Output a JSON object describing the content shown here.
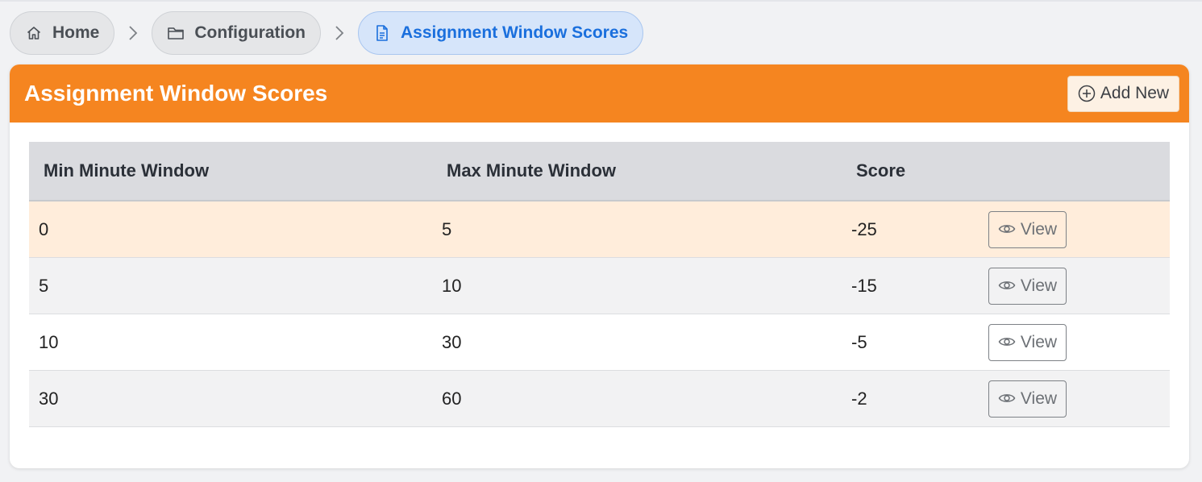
{
  "breadcrumb": {
    "items": [
      {
        "label": "Home",
        "icon": "home-icon"
      },
      {
        "label": "Configuration",
        "icon": "folder-icon"
      },
      {
        "label": "Assignment Window Scores",
        "icon": "document-icon"
      }
    ]
  },
  "card": {
    "title": "Assignment Window Scores",
    "add_label": "Add New",
    "accent_color": "#f58520"
  },
  "table": {
    "headers": [
      "Min Minute Window",
      "Max Minute Window",
      "Score",
      ""
    ],
    "rows": [
      {
        "min": "0",
        "max": "5",
        "score": "-25",
        "action": "View"
      },
      {
        "min": "5",
        "max": "10",
        "score": "-15",
        "action": "View"
      },
      {
        "min": "10",
        "max": "30",
        "score": "-5",
        "action": "View"
      },
      {
        "min": "30",
        "max": "60",
        "score": "-2",
        "action": "View"
      }
    ]
  }
}
